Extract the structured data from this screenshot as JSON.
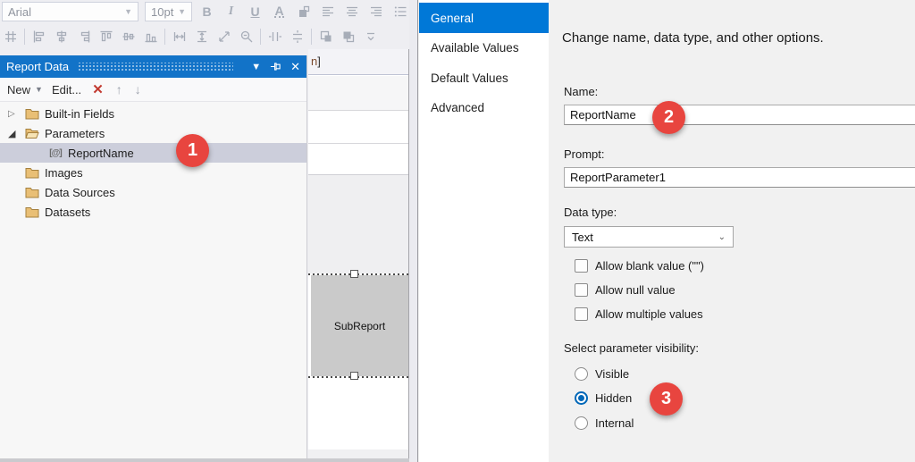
{
  "colors": {
    "panel_title_blue": "#1273c8",
    "selected_tab_blue": "#0078d7",
    "tree_selection_gray": "#cccedb",
    "badge_red": "#e8453f",
    "radio_blue": "#0067b8",
    "folder_tan": "#e9bf75"
  },
  "toolbar": {
    "font_name": "Arial",
    "font_size": "10pt",
    "row1_icons": [
      "bold-icon",
      "italic-icon",
      "underline-icon",
      "font-color-icon",
      "fill-color-icon",
      "align-left-icon",
      "align-center-icon",
      "align-right-icon",
      "list-icon",
      "dots-icon"
    ],
    "row2_icons": [
      "snap-to-grid-icon",
      "separator",
      "align-lefts-icon",
      "align-centers-icon",
      "align-rights-icon",
      "align-tops-icon",
      "align-middles-icon",
      "align-bottoms-icon",
      "separator",
      "same-width-icon",
      "same-height-icon",
      "same-size-icon",
      "zoom-icon",
      "separator",
      "horizontal-spacing-icon",
      "vertical-spacing-icon",
      "separator",
      "bring-to-front-icon",
      "send-to-back-icon",
      "overflow-icon"
    ]
  },
  "report_data_panel": {
    "title": "Report Data",
    "window_icons": [
      "window-position-icon",
      "pin-icon",
      "close-icon"
    ],
    "toolbar": {
      "new_label": "New",
      "edit_label": "Edit...",
      "delete_icon": "delete-icon",
      "up_icon": "move-up-icon",
      "down_icon": "move-down-icon"
    },
    "tree": [
      {
        "label": "Built-in Fields",
        "icon": "folder-icon",
        "expander": "collapsed",
        "indent": 0,
        "selected": false,
        "badge": ""
      },
      {
        "label": "Parameters",
        "icon": "folder-open-icon",
        "expander": "expanded",
        "indent": 0,
        "selected": false,
        "badge": ""
      },
      {
        "label": "ReportName",
        "icon": "parameter-icon",
        "expander": "none",
        "indent": 1,
        "selected": true,
        "badge": "1"
      },
      {
        "label": "Images",
        "icon": "folder-icon",
        "expander": "none",
        "indent": 0,
        "selected": false,
        "badge": ""
      },
      {
        "label": "Data Sources",
        "icon": "folder-icon",
        "expander": "none",
        "indent": 0,
        "selected": false,
        "badge": ""
      },
      {
        "label": "Datasets",
        "icon": "folder-icon",
        "expander": "none",
        "indent": 0,
        "selected": false,
        "badge": ""
      }
    ]
  },
  "design_surface": {
    "expression_fragment_name": "n",
    "expression_fragment_bracket": "]",
    "subreport_label": "SubReport"
  },
  "dialog": {
    "tabs": [
      {
        "label": "General",
        "selected": true
      },
      {
        "label": "Available Values",
        "selected": false
      },
      {
        "label": "Default Values",
        "selected": false
      },
      {
        "label": "Advanced",
        "selected": false
      }
    ],
    "heading": "Change name, data type, and other options.",
    "fields": {
      "name": {
        "label": "Name:",
        "value": "ReportName",
        "badge": "2"
      },
      "prompt": {
        "label": "Prompt:",
        "value": "ReportParameter1"
      },
      "data_type": {
        "label": "Data type:",
        "value": "Text"
      }
    },
    "checkboxes": [
      {
        "label": "Allow blank value (\"\")",
        "checked": false
      },
      {
        "label": "Allow null value",
        "checked": false
      },
      {
        "label": "Allow multiple values",
        "checked": false
      }
    ],
    "visibility": {
      "label": "Select parameter visibility:",
      "options": [
        {
          "label": "Visible",
          "selected": false,
          "badge": ""
        },
        {
          "label": "Hidden",
          "selected": true,
          "badge": "3"
        },
        {
          "label": "Internal",
          "selected": false,
          "badge": ""
        }
      ]
    }
  }
}
